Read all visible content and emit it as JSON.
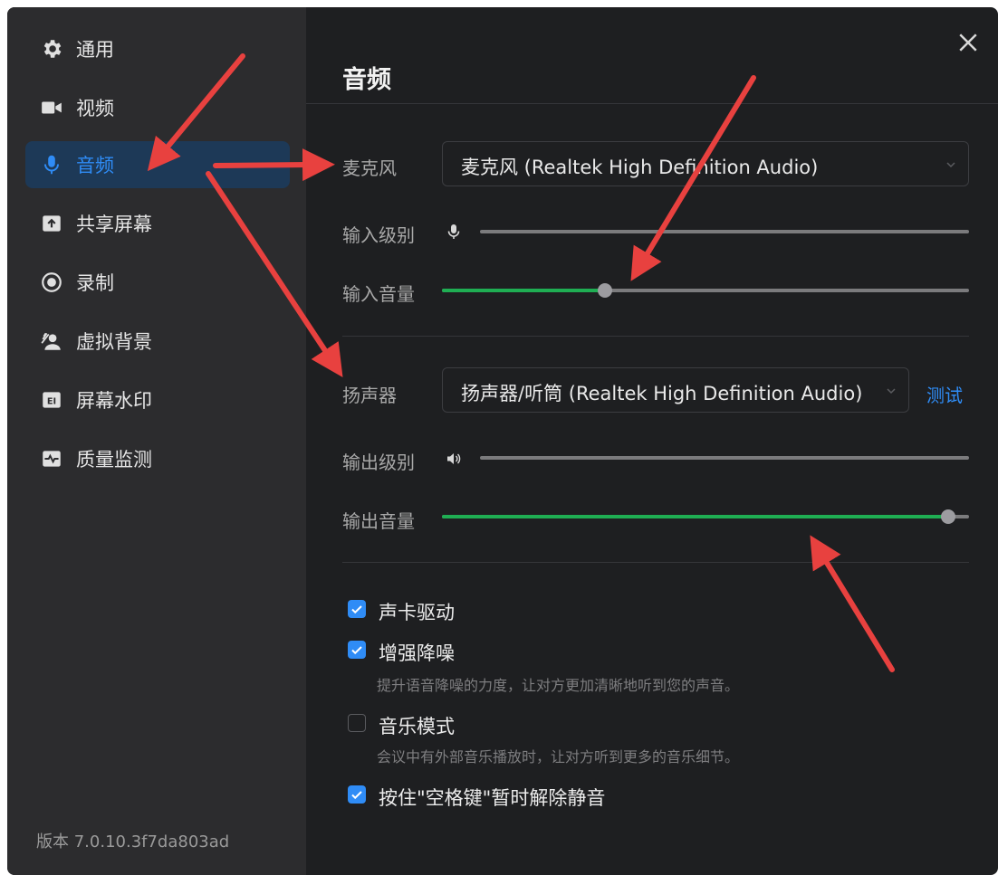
{
  "sidebar": {
    "items": [
      {
        "label": "通用",
        "icon": "gear-icon"
      },
      {
        "label": "视频",
        "icon": "video-camera-icon"
      },
      {
        "label": "音频",
        "icon": "microphone-icon",
        "active": true
      },
      {
        "label": "共享屏幕",
        "icon": "share-screen-icon"
      },
      {
        "label": "录制",
        "icon": "record-icon"
      },
      {
        "label": "虚拟背景",
        "icon": "virtual-background-icon"
      },
      {
        "label": "屏幕水印",
        "icon": "watermark-icon"
      },
      {
        "label": "质量监测",
        "icon": "quality-monitor-icon"
      }
    ],
    "version": "版本 7.0.10.3f7da803ad"
  },
  "main": {
    "title": "音频",
    "microphone": {
      "label": "麦克风",
      "device": "麦克风 (Realtek High Definition Audio)",
      "input_level_label": "输入级别",
      "input_volume_label": "输入音量",
      "input_level": 0,
      "input_volume": 0.31
    },
    "speaker": {
      "label": "扬声器",
      "device": "扬声器/听筒 (Realtek High Definition Audio)",
      "test_label": "测试",
      "output_level_label": "输出级别",
      "output_volume_label": "输出音量",
      "output_level": 0,
      "output_volume": 0.96
    },
    "options": [
      {
        "label": "声卡驱动",
        "checked": true,
        "desc": ""
      },
      {
        "label": "增强降噪",
        "checked": true,
        "desc": "提升语音降噪的力度，让对方更加清晰地听到您的声音。"
      },
      {
        "label": "音乐模式",
        "checked": false,
        "desc": "会议中有外部音乐播放时，让对方听到更多的音乐细节。"
      },
      {
        "label": "按住\"空格键\"暂时解除静音",
        "checked": true,
        "desc": ""
      }
    ]
  },
  "colors": {
    "accent": "#2f8cf6",
    "slider_fill": "#1fae53",
    "annotation_arrow": "#e8413f"
  }
}
